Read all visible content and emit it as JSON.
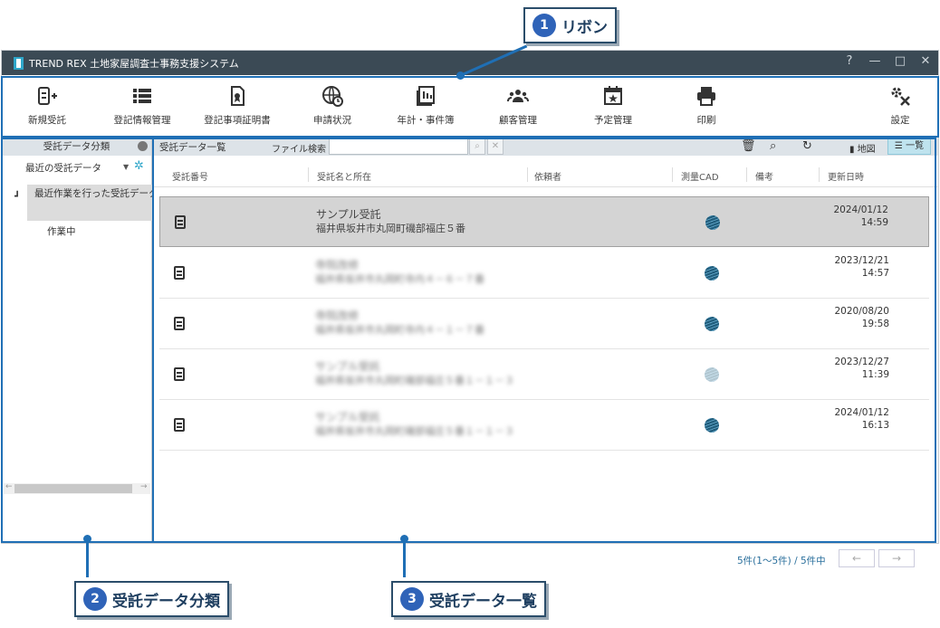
{
  "window": {
    "title": "TREND REX 土地家屋調査士事務支援システム",
    "controls": [
      "?",
      "—",
      "□",
      "✕"
    ]
  },
  "ribbon": {
    "buttons": [
      {
        "label": "新規受託",
        "icon": "new-entry-icon"
      },
      {
        "label": "登記情報管理",
        "icon": "list-icon"
      },
      {
        "label": "登記事項証明書",
        "icon": "certificate-icon"
      },
      {
        "label": "申請状況",
        "icon": "globe-clock-icon"
      },
      {
        "label": "年計・事件簿",
        "icon": "ledger-icon"
      },
      {
        "label": "顧客管理",
        "icon": "people-icon"
      },
      {
        "label": "予定管理",
        "icon": "calendar-icon"
      },
      {
        "label": "印刷",
        "icon": "printer-icon"
      },
      {
        "label": "設定",
        "icon": "settings-tools-icon"
      }
    ]
  },
  "left_panel": {
    "header": "受託データ分類",
    "selector": "最近の受託データ",
    "tree": [
      "最近作業を行った受託データ",
      "作業中"
    ]
  },
  "main": {
    "title": "受託データ一覧",
    "search_label": "ファイル検索",
    "search_value": "",
    "view_map": "地図",
    "view_list": "一覧",
    "columns": [
      "受託番号",
      "受託名と所在",
      "依頼者",
      "測量CAD",
      "備考",
      "更新日時"
    ],
    "rows": [
      {
        "name": "サンプル受託",
        "address": "福井県坂井市丸岡町磯部福庄５番",
        "date": "2024/01/12",
        "time": "14:59",
        "selected": true
      },
      {
        "name": "寺院改修",
        "address": "福井県坂井市丸岡町寺内４－６－７番",
        "date": "2023/12/21",
        "time": "14:57",
        "selected": false
      },
      {
        "name": "寺院改修",
        "address": "福井県坂井市丸岡町寺内４－１－７番",
        "date": "2020/08/20",
        "time": "19:58",
        "selected": false
      },
      {
        "name": "サンプル受託",
        "address": "福井県坂井市丸岡町磯部福庄５番１－１－３",
        "date": "2023/12/27",
        "time": "11:39",
        "selected": false
      },
      {
        "name": "サンプル受託",
        "address": "福井県坂井市丸岡町磯部福庄５番１－１－３",
        "date": "2024/01/12",
        "time": "16:13",
        "selected": false
      }
    ],
    "pager": "5件(1〜5件) / 5件中",
    "pager_prev": "←",
    "pager_next": "→"
  },
  "callouts": [
    {
      "num": "1",
      "text": "リボン"
    },
    {
      "num": "2",
      "text": "受託データ分類"
    },
    {
      "num": "3",
      "text": "受託データ一覧"
    }
  ],
  "colors": {
    "callout_blue": "#1f6fb5",
    "titlebar": "#3b4a55",
    "accent": "#2fa6c9"
  }
}
